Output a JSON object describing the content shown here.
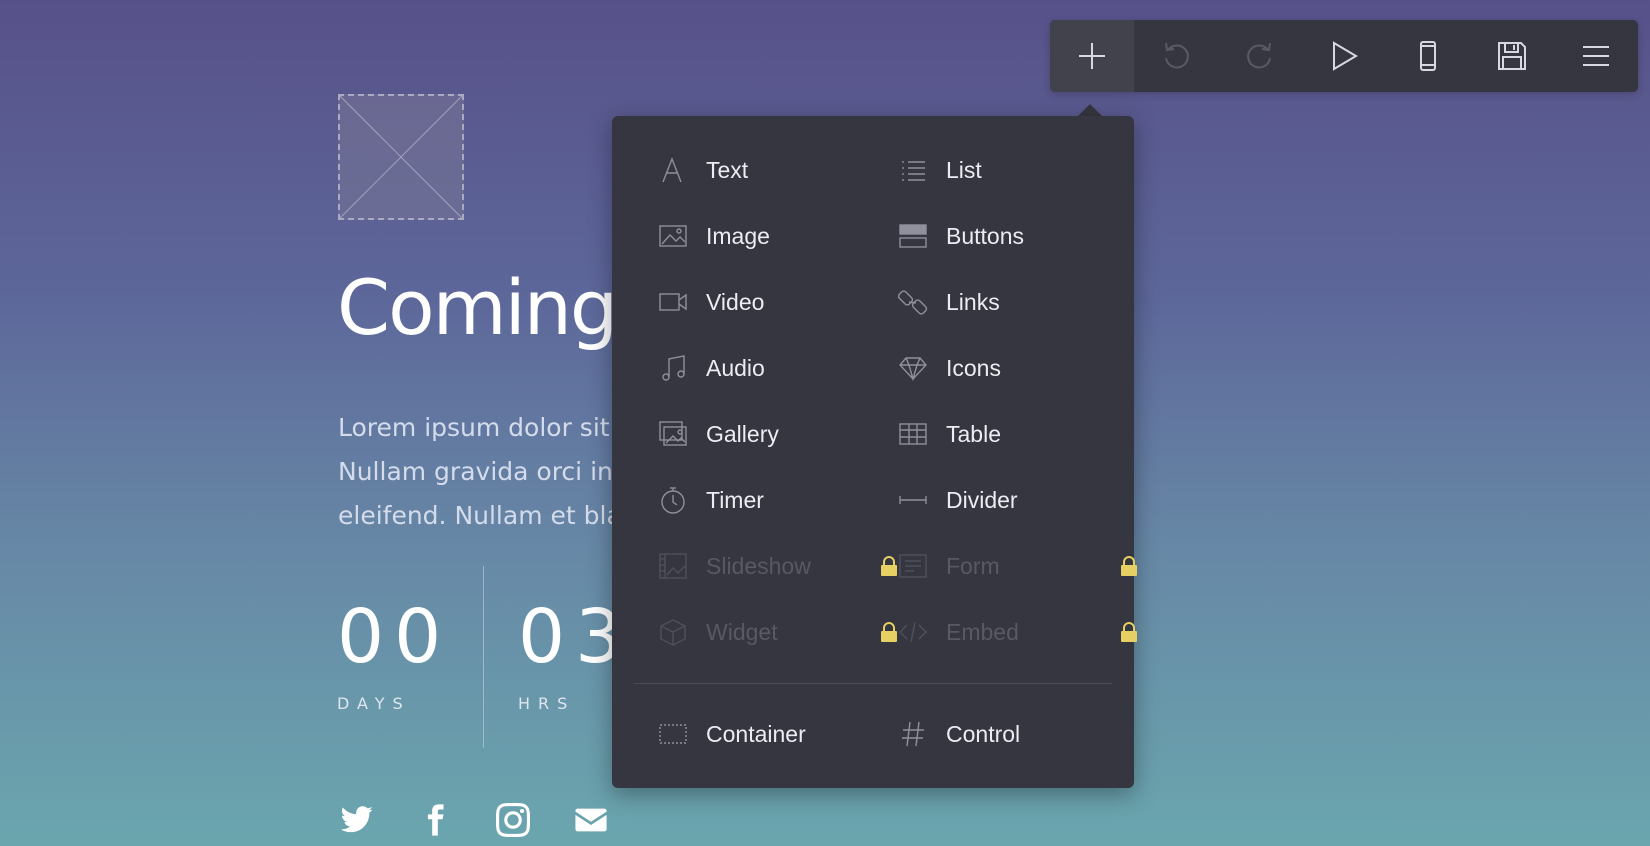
{
  "page": {
    "heading": "Coming",
    "paragraph_lines": [
      "Lorem ipsum dolor sit a",
      "Nullam gravida orci in e",
      "eleifend. Nullam et bla"
    ],
    "counters": [
      {
        "value": "00",
        "label": "DAYS"
      },
      {
        "value": "03",
        "label": "HRS"
      }
    ],
    "social": [
      "twitter-icon",
      "facebook-icon",
      "instagram-icon",
      "email-icon"
    ]
  },
  "toolbar": {
    "buttons": [
      {
        "name": "add",
        "icon": "plus-icon",
        "state": "active"
      },
      {
        "name": "undo",
        "icon": "undo-icon",
        "state": "disabled"
      },
      {
        "name": "redo",
        "icon": "redo-icon",
        "state": "disabled"
      },
      {
        "name": "preview",
        "icon": "play-icon",
        "state": "enabled"
      },
      {
        "name": "mobile",
        "icon": "mobile-icon",
        "state": "enabled"
      },
      {
        "name": "save",
        "icon": "save-icon",
        "state": "enabled"
      },
      {
        "name": "menu",
        "icon": "hamburger-icon",
        "state": "enabled"
      }
    ]
  },
  "add_menu": {
    "items": [
      {
        "label": "Text",
        "icon": "text-icon",
        "locked": false
      },
      {
        "label": "List",
        "icon": "list-icon",
        "locked": false
      },
      {
        "label": "Image",
        "icon": "image-icon",
        "locked": false
      },
      {
        "label": "Buttons",
        "icon": "buttons-icon",
        "locked": false
      },
      {
        "label": "Video",
        "icon": "video-icon",
        "locked": false
      },
      {
        "label": "Links",
        "icon": "link-icon",
        "locked": false
      },
      {
        "label": "Audio",
        "icon": "music-icon",
        "locked": false
      },
      {
        "label": "Icons",
        "icon": "diamond-icon",
        "locked": false
      },
      {
        "label": "Gallery",
        "icon": "gallery-icon",
        "locked": false
      },
      {
        "label": "Table",
        "icon": "table-icon",
        "locked": false
      },
      {
        "label": "Timer",
        "icon": "stopwatch-icon",
        "locked": false
      },
      {
        "label": "Divider",
        "icon": "divider-icon",
        "locked": false
      },
      {
        "label": "Slideshow",
        "icon": "slideshow-icon",
        "locked": true
      },
      {
        "label": "Form",
        "icon": "form-icon",
        "locked": true
      },
      {
        "label": "Widget",
        "icon": "cube-icon",
        "locked": true
      },
      {
        "label": "Embed",
        "icon": "code-icon",
        "locked": true
      }
    ],
    "footer_items": [
      {
        "label": "Container",
        "icon": "container-icon"
      },
      {
        "label": "Control",
        "icon": "hash-icon"
      }
    ]
  },
  "colors": {
    "toolbar_bg": "#35363f",
    "menu_bg": "#35363f",
    "lock_color": "#e6cf63",
    "gradient_top": "#575189",
    "gradient_bottom": "#6aa6ae"
  }
}
